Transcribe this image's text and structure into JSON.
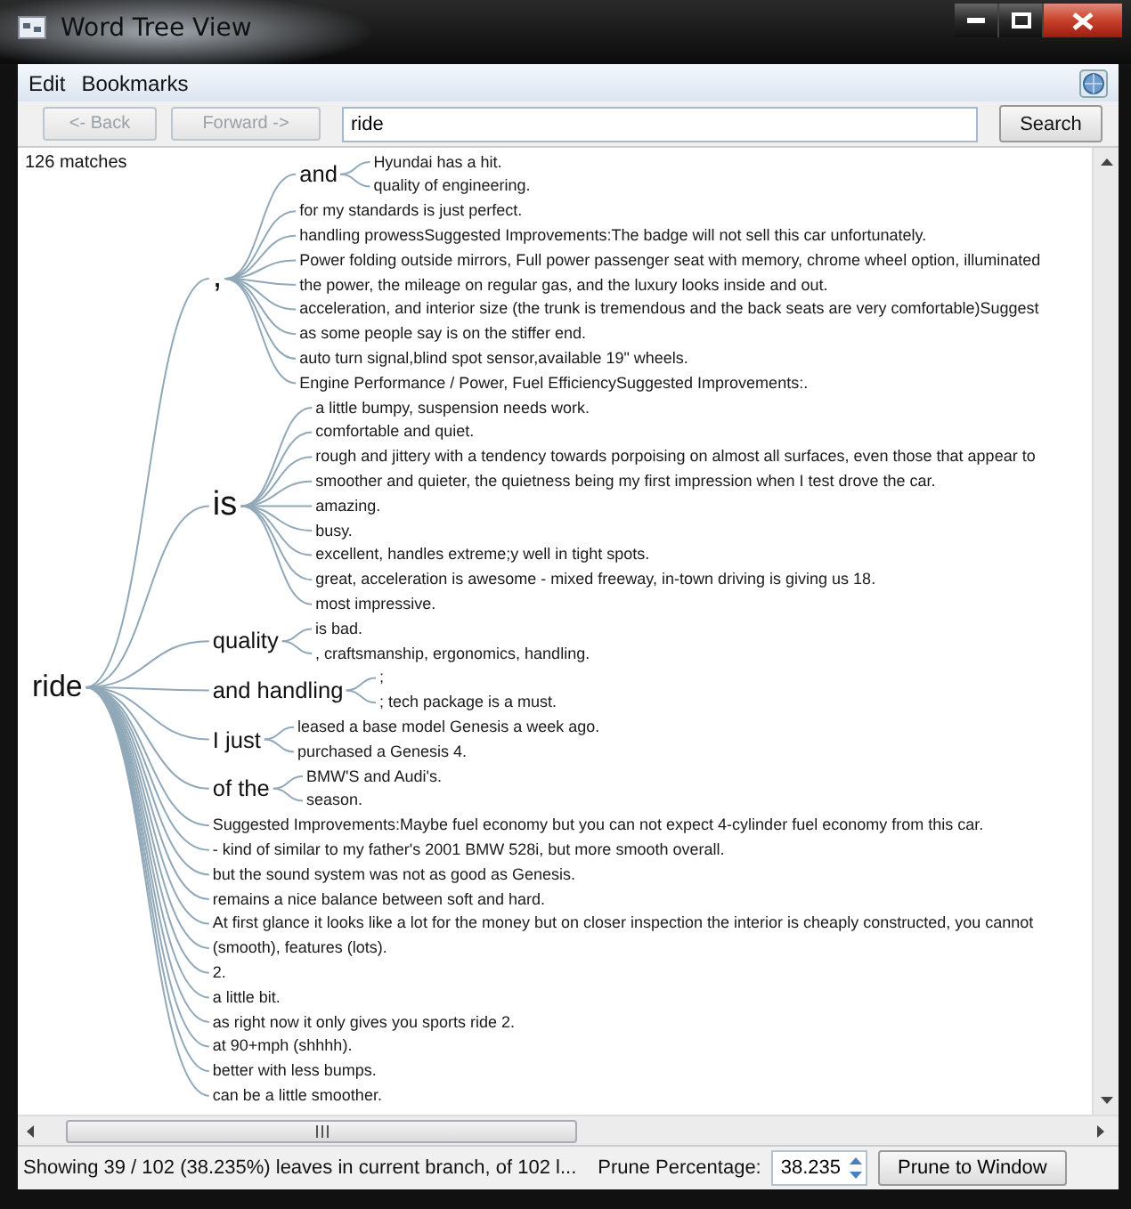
{
  "window": {
    "title": "Word Tree View"
  },
  "menu": [
    {
      "label": "Edit"
    },
    {
      "label": "Bookmarks"
    }
  ],
  "toolbar": {
    "back": {
      "label": "<- Back",
      "disabled": true
    },
    "forward": {
      "label": "Forward ->",
      "disabled": true
    },
    "search_field": {
      "value": "ride"
    },
    "search_button": "Search"
  },
  "match_count": "126 matches",
  "word_tree": {
    "label": "ride",
    "children": [
      {
        "label": ",",
        "children": [
          {
            "label": "and",
            "children": [
              {
                "label": "Hyundai has a hit."
              },
              {
                "label": "quality of engineering."
              }
            ]
          },
          {
            "label": "for my standards is just perfect."
          },
          {
            "label": "handling prowessSuggested Improvements:The badge will not sell this car unfortunately."
          },
          {
            "label": "Power folding outside mirrors, Full power passenger seat with memory, chrome wheel option, illuminated"
          },
          {
            "label": "the power, the mileage on regular gas, and the luxury looks inside and out."
          },
          {
            "label": "acceleration, and interior size (the trunk is tremendous and the back seats are very comfortable)Suggest"
          },
          {
            "label": "as some people say is on the stiffer end."
          },
          {
            "label": "auto turn signal,blind spot sensor,available 19\" wheels."
          },
          {
            "label": "Engine Performance / Power, Fuel EfficiencySuggested Improvements:."
          }
        ]
      },
      {
        "label": "is",
        "children": [
          {
            "label": "a little bumpy, suspension needs work."
          },
          {
            "label": "comfortable and quiet."
          },
          {
            "label": "rough and jittery with a tendency towards porpoising on almost all surfaces, even those that appear to"
          },
          {
            "label": "smoother and quieter, the quietness being my first impression when I test drove the car."
          },
          {
            "label": "amazing."
          },
          {
            "label": "busy."
          },
          {
            "label": "excellent, handles extreme;y well in tight spots."
          },
          {
            "label": "great, acceleration is awesome - mixed freeway, in-town driving is giving us 18."
          },
          {
            "label": "most impressive."
          }
        ]
      },
      {
        "label": "quality",
        "children": [
          {
            "label": "is bad."
          },
          {
            "label": ", craftsmanship, ergonomics, handling."
          }
        ]
      },
      {
        "label": "and handling",
        "children": [
          {
            "label": ";"
          },
          {
            "label": "; tech package is a must."
          }
        ]
      },
      {
        "label": "I just",
        "children": [
          {
            "label": "leased a base model Genesis a week ago."
          },
          {
            "label": "purchased a Genesis 4."
          }
        ]
      },
      {
        "label": "of the",
        "children": [
          {
            "label": "BMW'S and Audi's."
          },
          {
            "label": "season."
          }
        ]
      },
      {
        "label": "Suggested Improvements:Maybe fuel economy but you can not expect 4-cylinder fuel economy from this car."
      },
      {
        "label": "- kind of similar to my father's 2001 BMW 528i, but more smooth overall."
      },
      {
        "label": "but the sound system was not as good as Genesis."
      },
      {
        "label": "remains a nice balance between soft and hard."
      },
      {
        "label": "At first glance it looks like a lot for the money but on closer inspection the interior is cheaply constructed, you cannot"
      },
      {
        "label": "(smooth), features (lots)."
      },
      {
        "label": "2."
      },
      {
        "label": "a little bit."
      },
      {
        "label": "as right now it only gives you sports ride 2."
      },
      {
        "label": "at 90+mph (shhhh)."
      },
      {
        "label": "better with less bumps."
      },
      {
        "label": "can be a little smoother."
      }
    ]
  },
  "status_bar": {
    "text": "Showing 39 / 102 (38.235%) leaves in current branch, of 102 l...",
    "prune_label": "Prune Percentage:",
    "prune_value": "38.235",
    "prune_button": "Prune to Window"
  }
}
